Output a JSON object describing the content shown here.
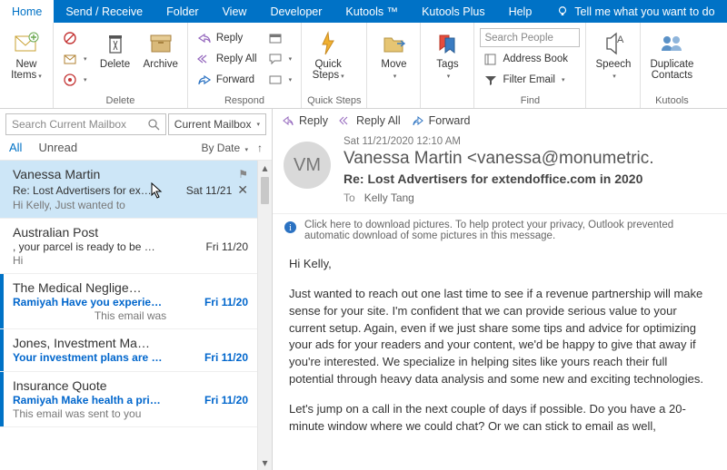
{
  "tabs": [
    "Home",
    "Send / Receive",
    "Folder",
    "View",
    "Developer",
    "Kutools ™",
    "Kutools Plus",
    "Help"
  ],
  "activeTab": 0,
  "tell": "Tell me what you want to do",
  "ribbon": {
    "new": {
      "label": "New\nItems",
      "group": ""
    },
    "delete": {
      "delete": "Delete",
      "archive": "Archive",
      "group": "Delete"
    },
    "respond": {
      "reply": "Reply",
      "replyall": "Reply All",
      "forward": "Forward",
      "group": "Respond"
    },
    "quicksteps": {
      "label": "Quick\nSteps",
      "group": "Quick Steps"
    },
    "move": {
      "label": "Move",
      "group": ""
    },
    "tags": {
      "label": "Tags",
      "group": ""
    },
    "find": {
      "search": "Search People",
      "ab": "Address Book",
      "filter": "Filter Email",
      "group": "Find"
    },
    "speech": {
      "label": "Speech",
      "group": ""
    },
    "kutools": {
      "label": "Duplicate\nContacts",
      "group": "Kutools"
    }
  },
  "search": {
    "placeholder": "Search Current Mailbox",
    "scope": "Current Mailbox"
  },
  "filters": {
    "all": "All",
    "unread": "Unread",
    "sort": "By Date"
  },
  "messages": [
    {
      "sender": "Vanessa Martin",
      "subject": "Re: Lost Advertisers for ex…",
      "date": "Sat 11/21",
      "preview": "Hi Kelly,  Just wanted to",
      "unread": false,
      "selected": true,
      "flag": true
    },
    {
      "sender": "Australian Post",
      "subject": ", your parcel is ready to be …",
      "date": "Fri 11/20",
      "preview": "Hi",
      "unread": false,
      "selected": false
    },
    {
      "sender": "The Medical Neglige…",
      "subject": "Ramiyah Have you experie…",
      "date": "Fri 11/20",
      "preview": "This email was",
      "unread": true,
      "selected": false
    },
    {
      "sender": "Jones, Investment Ma…",
      "subject": "Your investment plans are …",
      "date": "Fri 11/20",
      "preview": "",
      "unread": true,
      "selected": false
    },
    {
      "sender": "Insurance Quote",
      "subject": "Ramiyah Make health a pri…",
      "date": "Fri 11/20",
      "preview": "This email was sent to you",
      "unread": true,
      "selected": false
    }
  ],
  "reading": {
    "actions": {
      "reply": "Reply",
      "replyall": "Reply All",
      "forward": "Forward"
    },
    "date": "Sat 11/21/2020 12:10 AM",
    "from": "Vanessa Martin <vanessa@monumetric.",
    "avatar": "VM",
    "subject": "Re: Lost Advertisers for extendoffice.com in 2020",
    "toLabel": "To",
    "to": "Kelly Tang",
    "info": "Click here to download pictures. To help protect your privacy, Outlook prevented automatic download of some pictures in this message.",
    "greeting": "Hi Kelly,",
    "p1": "Just wanted to reach out one last time to see if a revenue partnership will make sense for your site. I'm confident that we can provide serious value to your current setup. Again, even if we just share some tips and advice for optimizing your ads for your readers and your content, we'd be happy to give that away if you're interested. We specialize in helping sites like yours reach their full potential through heavy data analysis and some new and exciting technologies.",
    "p2": "Let's jump on a call in the next couple of days if possible. Do you have a 20-minute window where we could chat? Or we can stick to email as well,"
  }
}
